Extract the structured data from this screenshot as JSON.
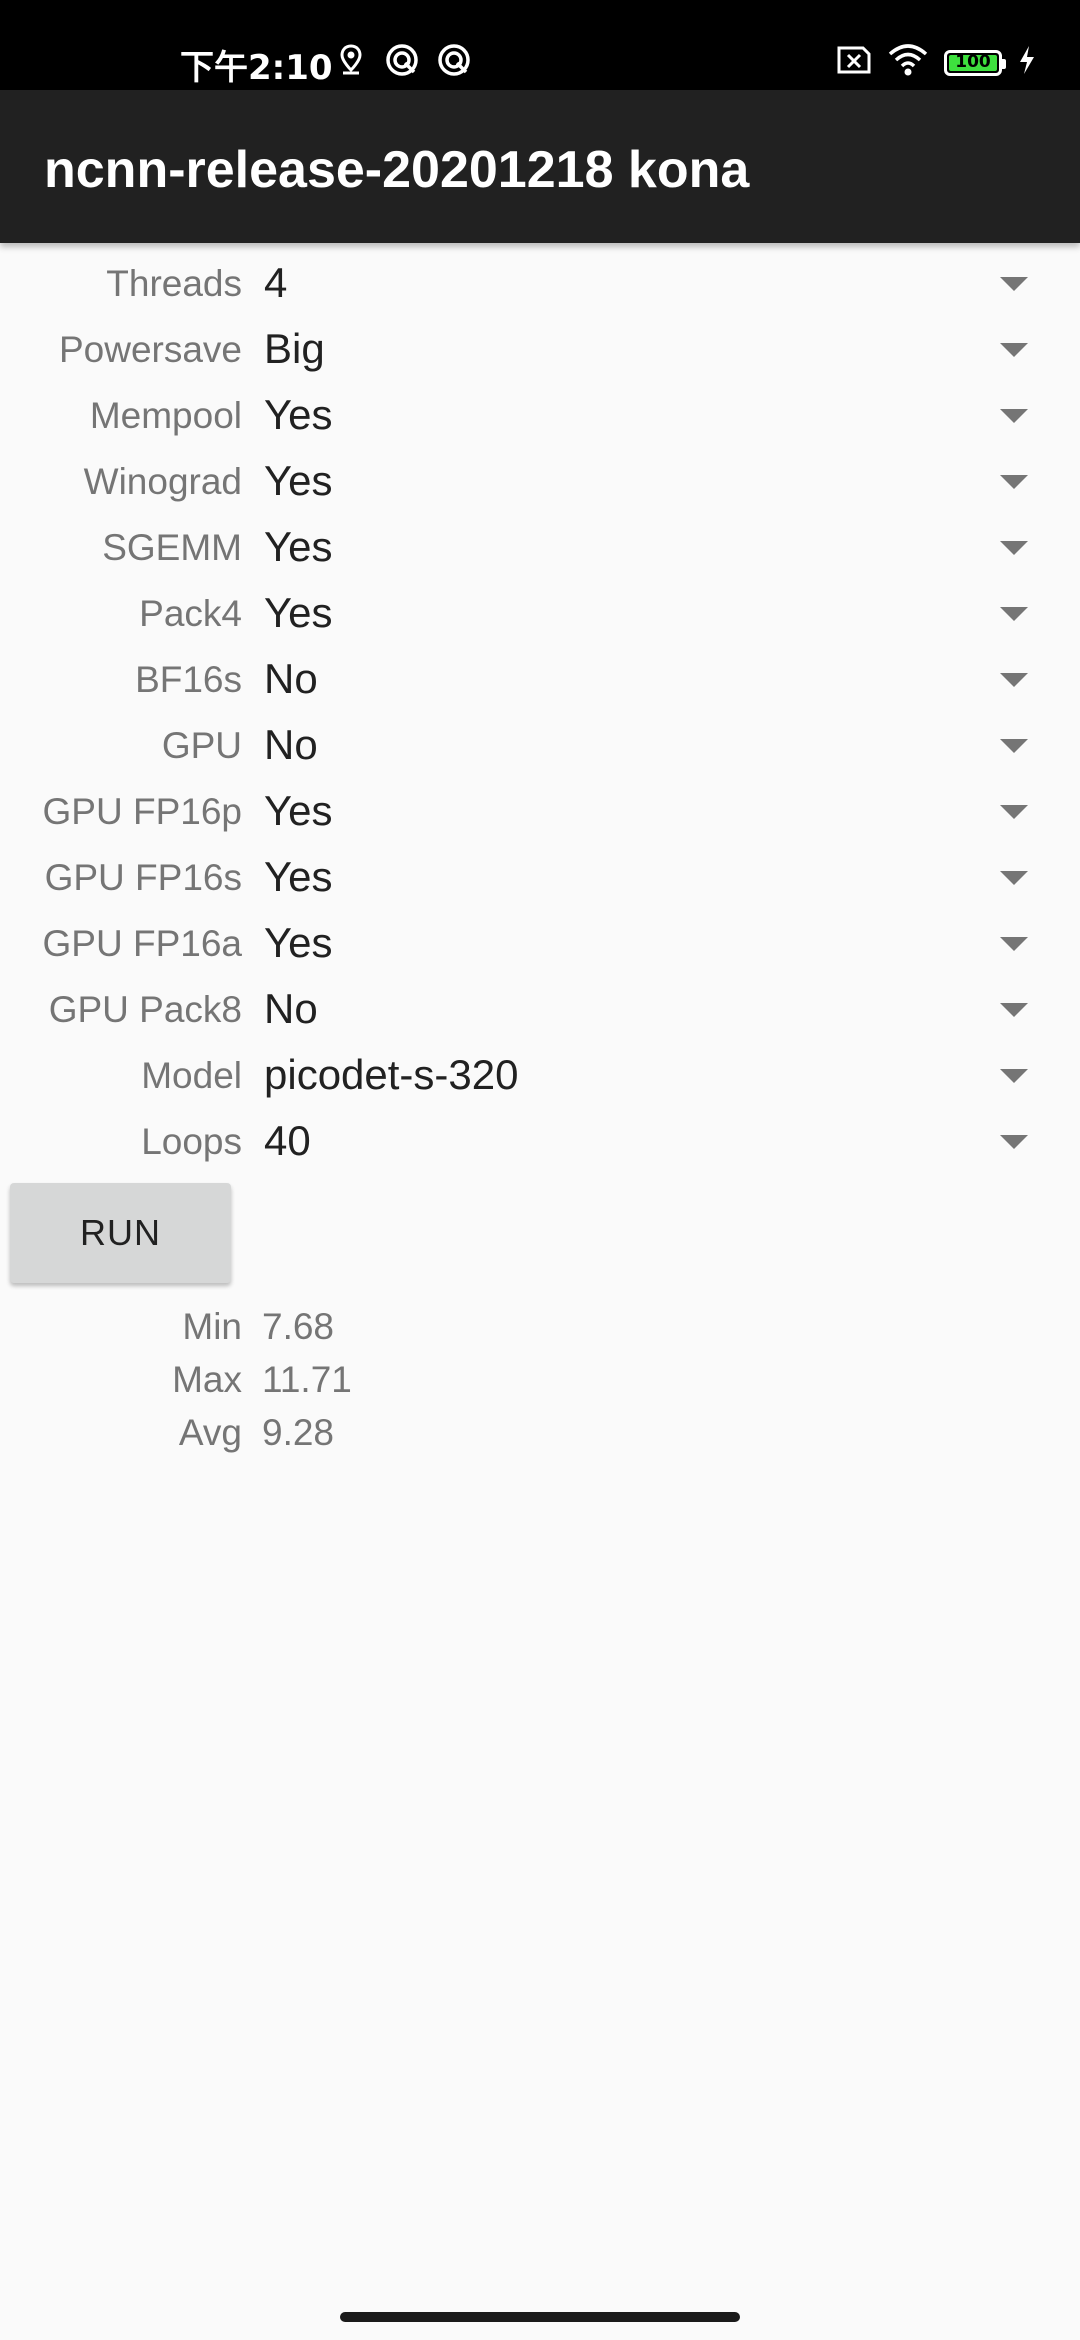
{
  "status_bar": {
    "time": "下午2:10",
    "battery_level": "100",
    "battery_fraction": 1.0,
    "left_icons": [
      "location-icon",
      "sync-icon",
      "sync-icon"
    ],
    "right_icons": [
      "sim-off-icon",
      "wifi-icon",
      "battery-icon",
      "charging-icon"
    ],
    "battery_color": "#3ee03e"
  },
  "app_bar": {
    "title": "ncnn-release-20201218 kona",
    "background": "#212121"
  },
  "settings": [
    {
      "label": "Threads",
      "value": "4"
    },
    {
      "label": "Powersave",
      "value": "Big"
    },
    {
      "label": "Mempool",
      "value": "Yes"
    },
    {
      "label": "Winograd",
      "value": "Yes"
    },
    {
      "label": "SGEMM",
      "value": "Yes"
    },
    {
      "label": "Pack4",
      "value": "Yes"
    },
    {
      "label": "BF16s",
      "value": "No"
    },
    {
      "label": "GPU",
      "value": "No"
    },
    {
      "label": "GPU FP16p",
      "value": "Yes"
    },
    {
      "label": "GPU FP16s",
      "value": "Yes"
    },
    {
      "label": "GPU FP16a",
      "value": "Yes"
    },
    {
      "label": "GPU Pack8",
      "value": "No"
    },
    {
      "label": "Model",
      "value": "picodet-s-320"
    },
    {
      "label": "Loops",
      "value": "40"
    }
  ],
  "run_button": {
    "label": "RUN"
  },
  "results": [
    {
      "label": "Min",
      "value": "7.68"
    },
    {
      "label": "Max",
      "value": "11.71"
    },
    {
      "label": "Avg",
      "value": "9.28"
    }
  ]
}
